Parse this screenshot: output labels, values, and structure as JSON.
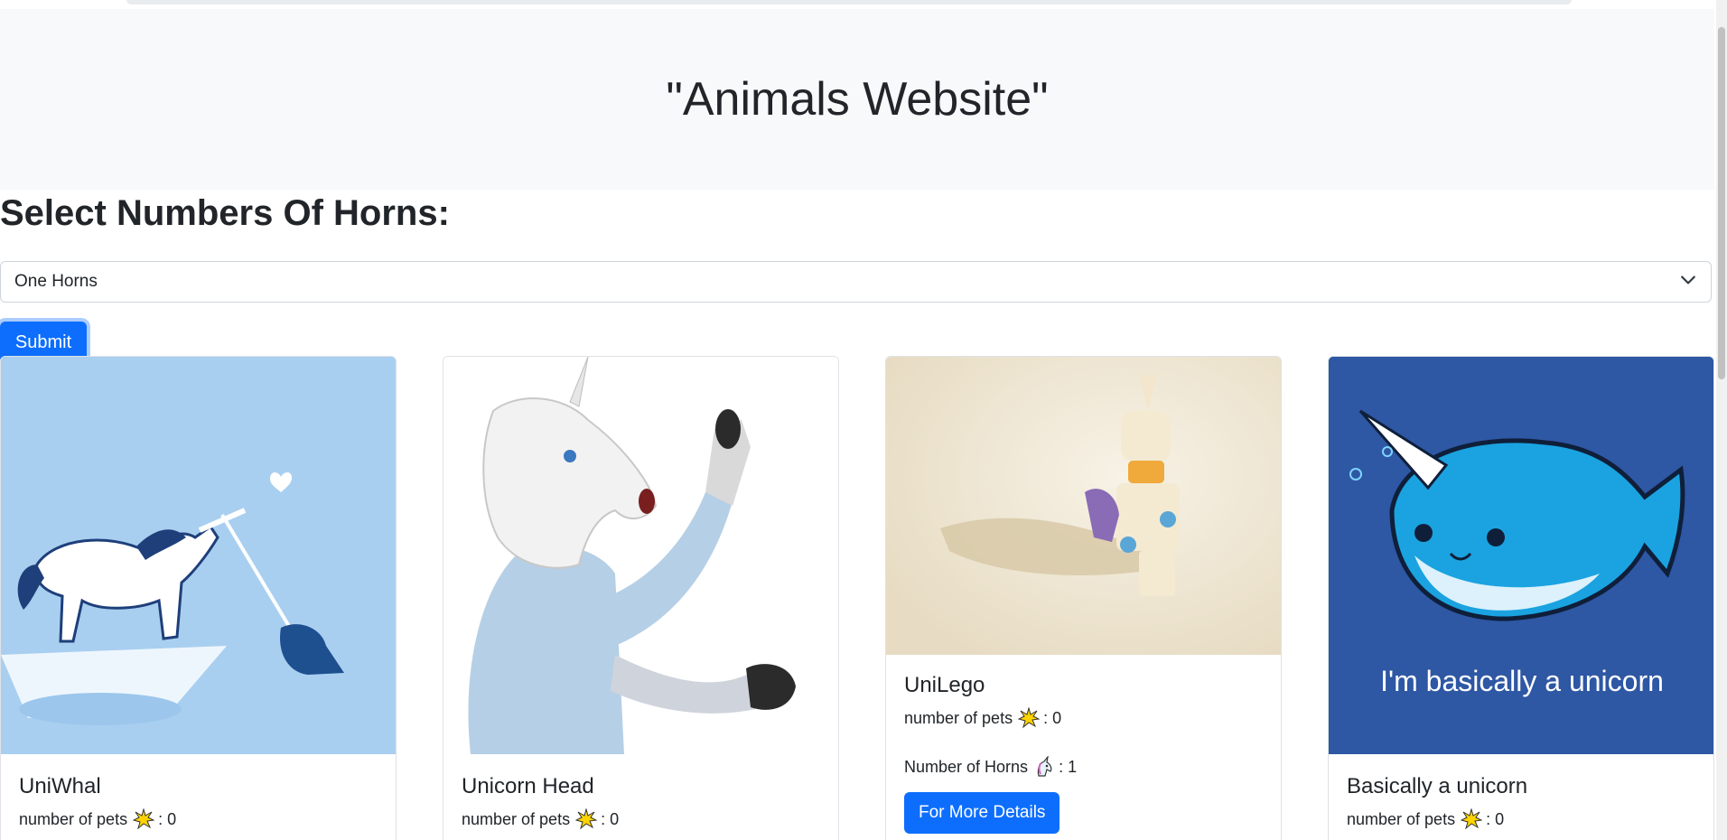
{
  "header": {
    "title": "\"Animals Website\""
  },
  "filter": {
    "title": "Select Numbers Of Horns:",
    "selected": "One Horns",
    "submit_label": "Submit"
  },
  "cards": [
    {
      "title": "UniWhal",
      "pets_label": "number of pets",
      "pets_value": ": 0"
    },
    {
      "title": "Unicorn Head",
      "pets_label": "number of pets",
      "pets_value": ": 0"
    },
    {
      "title": "UniLego",
      "pets_label": "number of pets",
      "pets_value": ": 0",
      "horns_label": "Number of Horns",
      "horns_value": ": 1",
      "button_label": "For More Details"
    },
    {
      "title": "Basically a unicorn",
      "pets_label": "number of pets",
      "pets_value": ": 0",
      "image_caption": "I'm basically a unicorn"
    }
  ],
  "colors": {
    "primary": "#0d6efd",
    "header_bg": "#f8f9fa",
    "text": "#212529"
  },
  "icons": {
    "pets": "sparkle-burst-icon",
    "horns": "unicorn-face-icon",
    "select": "chevron-down-icon"
  }
}
